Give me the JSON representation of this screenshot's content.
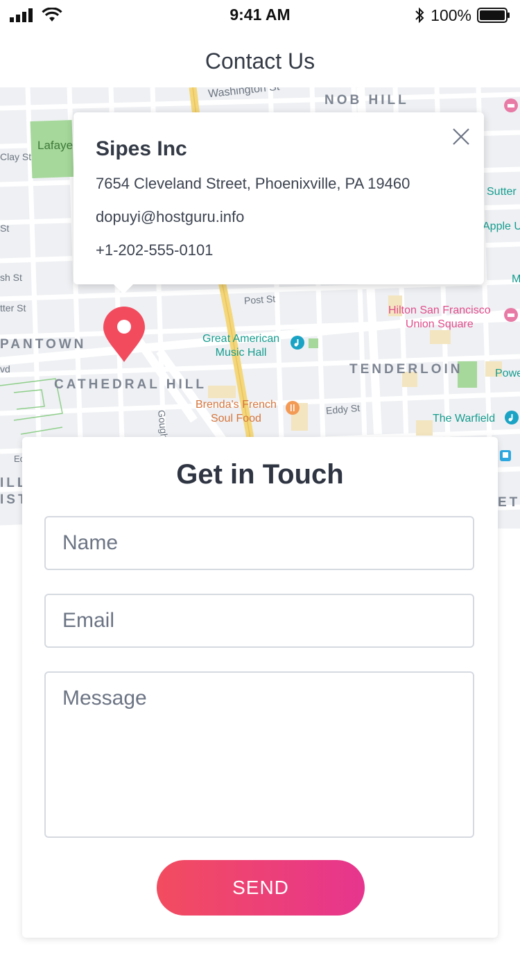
{
  "status_bar": {
    "time": "9:41 AM",
    "battery": "100%"
  },
  "header": {
    "title": "Contact Us"
  },
  "map": {
    "labels": {
      "washington": "Washington St",
      "nob_hill": "NOB HILL",
      "lafayette": "Lafaye",
      "clay": "Clay St",
      "st1": "St",
      "sh_st": "sh St",
      "tter_st": "tter St",
      "post": "Post St",
      "sutter": "Sutter",
      "apple": "Apple U",
      "m": "M",
      "pantown": "PANTOWN",
      "vd": "vd",
      "cathedral": "CATHEDRAL HILL",
      "gough": "Gough",
      "tenderloin": "TENDERLOIN",
      "powe": "Powe",
      "eddy": "Eddy St",
      "ill": "ILL",
      "ist": "IST",
      "et": "ET",
      "ec": "Ec"
    },
    "pois": {
      "hilton_1": "Hilton San Francisco",
      "hilton_2": "Union Square",
      "music_1": "Great American",
      "music_2": "Music Hall",
      "brenda_1": "Brenda's French",
      "brenda_2": "Soul Food",
      "warfield": "The Warfield"
    },
    "colors": {
      "highway": "#f4d77a",
      "park": "#a5d89a",
      "pin": "#f24b5e"
    }
  },
  "info_card": {
    "name": "Sipes Inc",
    "address": "7654 Cleveland Street, Phoenixville, PA 19460",
    "email": "dopuyi@hostguru.info",
    "phone": "+1-202-555-0101"
  },
  "form": {
    "title": "Get in Touch",
    "name_placeholder": "Name",
    "email_placeholder": "Email",
    "message_placeholder": "Message",
    "send_label": "SEND"
  }
}
